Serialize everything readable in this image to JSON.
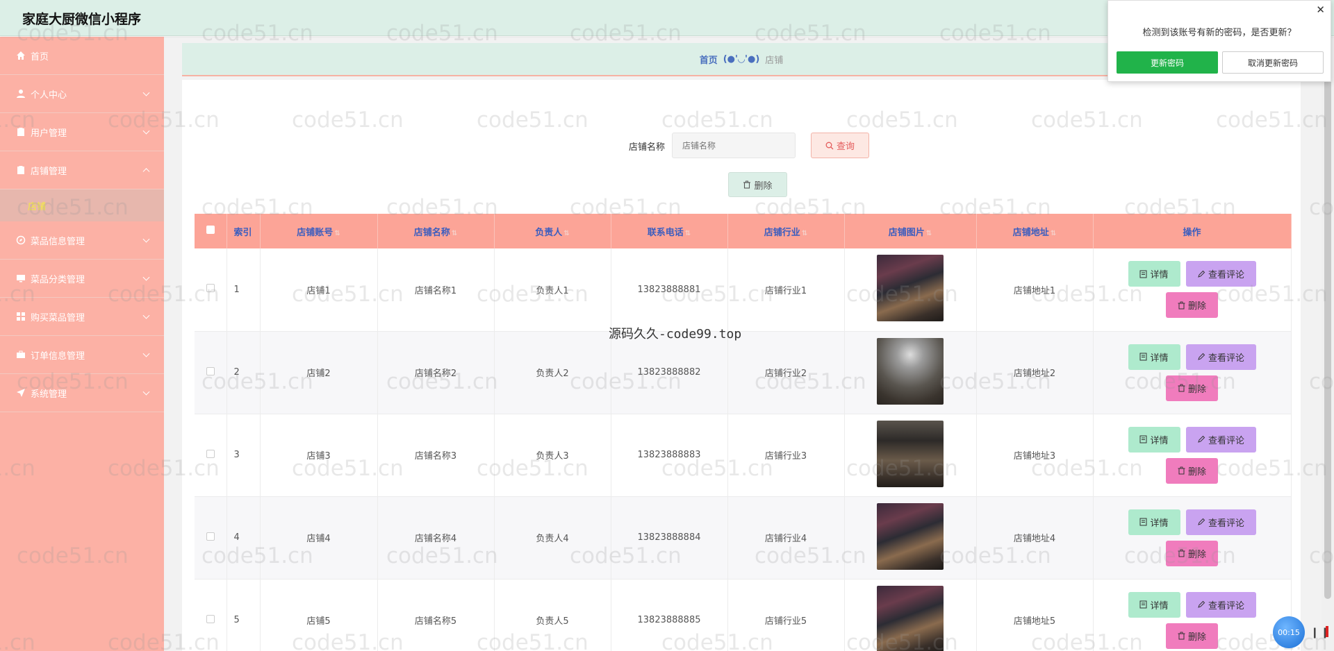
{
  "header": {
    "title": "家庭大厨微信小程序"
  },
  "sidebar": {
    "items": [
      {
        "label": "首页",
        "icon": "home-icon"
      },
      {
        "label": "个人中心",
        "icon": "user-icon"
      },
      {
        "label": "用户管理",
        "icon": "clipboard-icon"
      },
      {
        "label": "店铺管理",
        "icon": "clipboard-icon",
        "expanded": true,
        "sub": "店铺"
      },
      {
        "label": "菜品信息管理",
        "icon": "compass-icon"
      },
      {
        "label": "菜品分类管理",
        "icon": "monitor-icon"
      },
      {
        "label": "购买菜品管理",
        "icon": "grid-icon"
      },
      {
        "label": "订单信息管理",
        "icon": "briefcase-icon"
      },
      {
        "label": "系统管理",
        "icon": "send-icon"
      }
    ]
  },
  "breadcrumb": {
    "home": "首页",
    "face": "(●'◡'●)",
    "current": "店铺"
  },
  "search": {
    "label": "店铺名称",
    "placeholder": "店铺名称",
    "button": "查询"
  },
  "toolbar": {
    "delete": "删除"
  },
  "table": {
    "headers": {
      "index": "索引",
      "account": "店铺账号",
      "name": "店铺名称",
      "owner": "负责人",
      "phone": "联系电话",
      "industry": "店铺行业",
      "image": "店铺图片",
      "address": "店铺地址",
      "actions": "操作"
    },
    "rows": [
      {
        "index": "1",
        "account": "店铺1",
        "name": "店铺名称1",
        "owner": "负责人1",
        "phone": "13823888881",
        "industry": "店铺行业1",
        "address": "店铺地址1"
      },
      {
        "index": "2",
        "account": "店铺2",
        "name": "店铺名称2",
        "owner": "负责人2",
        "phone": "13823888882",
        "industry": "店铺行业2",
        "address": "店铺地址2"
      },
      {
        "index": "3",
        "account": "店铺3",
        "name": "店铺名称3",
        "owner": "负责人3",
        "phone": "13823888883",
        "industry": "店铺行业3",
        "address": "店铺地址3"
      },
      {
        "index": "4",
        "account": "店铺4",
        "name": "店铺名称4",
        "owner": "负责人4",
        "phone": "13823888884",
        "industry": "店铺行业4",
        "address": "店铺地址4"
      },
      {
        "index": "5",
        "account": "店铺5",
        "name": "店铺名称5",
        "owner": "负责人5",
        "phone": "13823888885",
        "industry": "店铺行业5",
        "address": "店铺地址5"
      }
    ],
    "actions": {
      "detail": "详情",
      "review": "查看评论",
      "delete": "删除"
    }
  },
  "popup": {
    "message": "检测到该账号有新的密码，是否更新？",
    "update": "更新密码",
    "cancel": "取消更新密码",
    "close": "✕"
  },
  "watermark": {
    "text": "code51.cn",
    "center": "源码久久-code99.top"
  },
  "timer": {
    "time": "00:15"
  },
  "colors": {
    "sidebar": "#fcb1a5",
    "header": "#dcefe7",
    "table_header": "#fca497",
    "accent_text": "#3a5dbf"
  }
}
